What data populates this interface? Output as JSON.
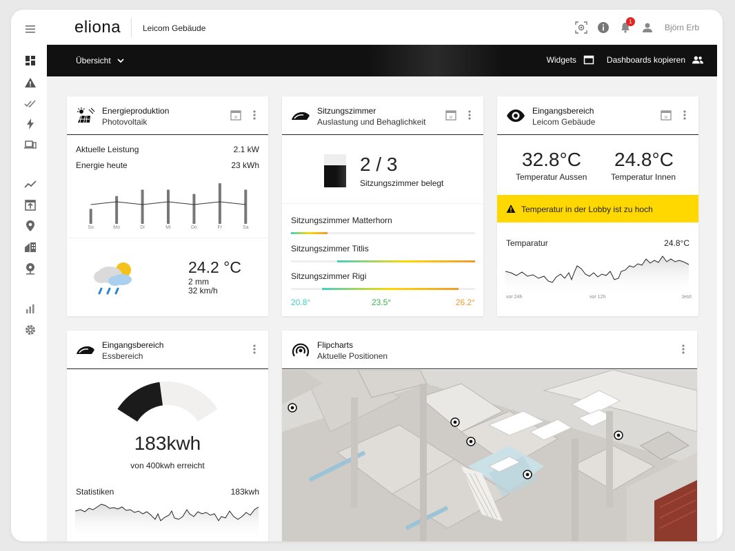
{
  "app": {
    "logo": "eliona",
    "building": "Leicom Gebäude",
    "user": "Björn Erb",
    "notification_count": "1"
  },
  "nav": {
    "tab": "Übersicht",
    "widgets": "Widgets",
    "copy": "Dashboards kopieren"
  },
  "sidebar": {
    "icons": [
      "menu-icon",
      "dashboard-icon",
      "alert-icon",
      "check-icon",
      "lightning-icon",
      "devices-icon",
      "trend-icon",
      "upload-icon",
      "location-icon",
      "building-icon",
      "tour-icon",
      "stats-icon",
      "settings-icon"
    ]
  },
  "energy": {
    "title": "Energieproduktion",
    "subtitle": "Photovoltaik",
    "current_label": "Aktuelle Leistung",
    "current_value": "2.1 kW",
    "today_label": "Energie heute",
    "today_value": "23 kWh",
    "days": [
      "So",
      "Mo",
      "Di",
      "Mi",
      "Do",
      "Fr",
      "Sa"
    ],
    "bar_values": [
      0.35,
      0.65,
      0.8,
      0.8,
      0.7,
      0.95,
      0.8
    ],
    "weather_temp": "24.2 °C",
    "weather_rain": "2 mm",
    "weather_wind": "32 km/h"
  },
  "meeting": {
    "title": "Sitzungszimmer",
    "subtitle": "Auslastung und Behaglichkeit",
    "occupancy": "2 / 3",
    "occupancy_label": "Sitzungszimmer belegt",
    "occupancy_fraction": 0.67,
    "rooms": [
      {
        "name": "Sitzungszimmer Matterhorn",
        "from": 0.0,
        "to": 0.2
      },
      {
        "name": "Sitzungszimmer Titlis",
        "from": 0.25,
        "to": 1.0
      },
      {
        "name": "Sitzungszimmer Rigi",
        "from": 0.17,
        "to": 0.91
      }
    ],
    "scale_min": "20.8°",
    "scale_mid": "23.5°",
    "scale_max": "26.2°"
  },
  "entrance": {
    "title": "Eingangsbereich",
    "subtitle": "Leicom Gebäude",
    "temp_out": "32.8°C",
    "temp_out_label": "Temperatur Aussen",
    "temp_in": "24.8°C",
    "temp_in_label": "Temperatur Innen",
    "alert": "Temperatur in der Lobby ist zu hoch",
    "chart_label": "Temparatur",
    "chart_value": "24.8°C",
    "axis": [
      "vor 24h",
      "vor 12h",
      "Jetzt"
    ]
  },
  "dining": {
    "title": "Eingangsbereich",
    "subtitle": "Essbereich",
    "value": "183kwh",
    "target": "von 400kwh erreicht",
    "fraction": 0.4575,
    "stats_label": "Statistiken",
    "stats_value": "183kwh"
  },
  "flipcharts": {
    "title": "Flipcharts",
    "subtitle": "Aktuelle Positionen"
  },
  "colors": {
    "accent_yellow": "#ffd800",
    "teal": "#3fd1c4",
    "orange": "#f29a2e",
    "green": "#39b24a"
  }
}
